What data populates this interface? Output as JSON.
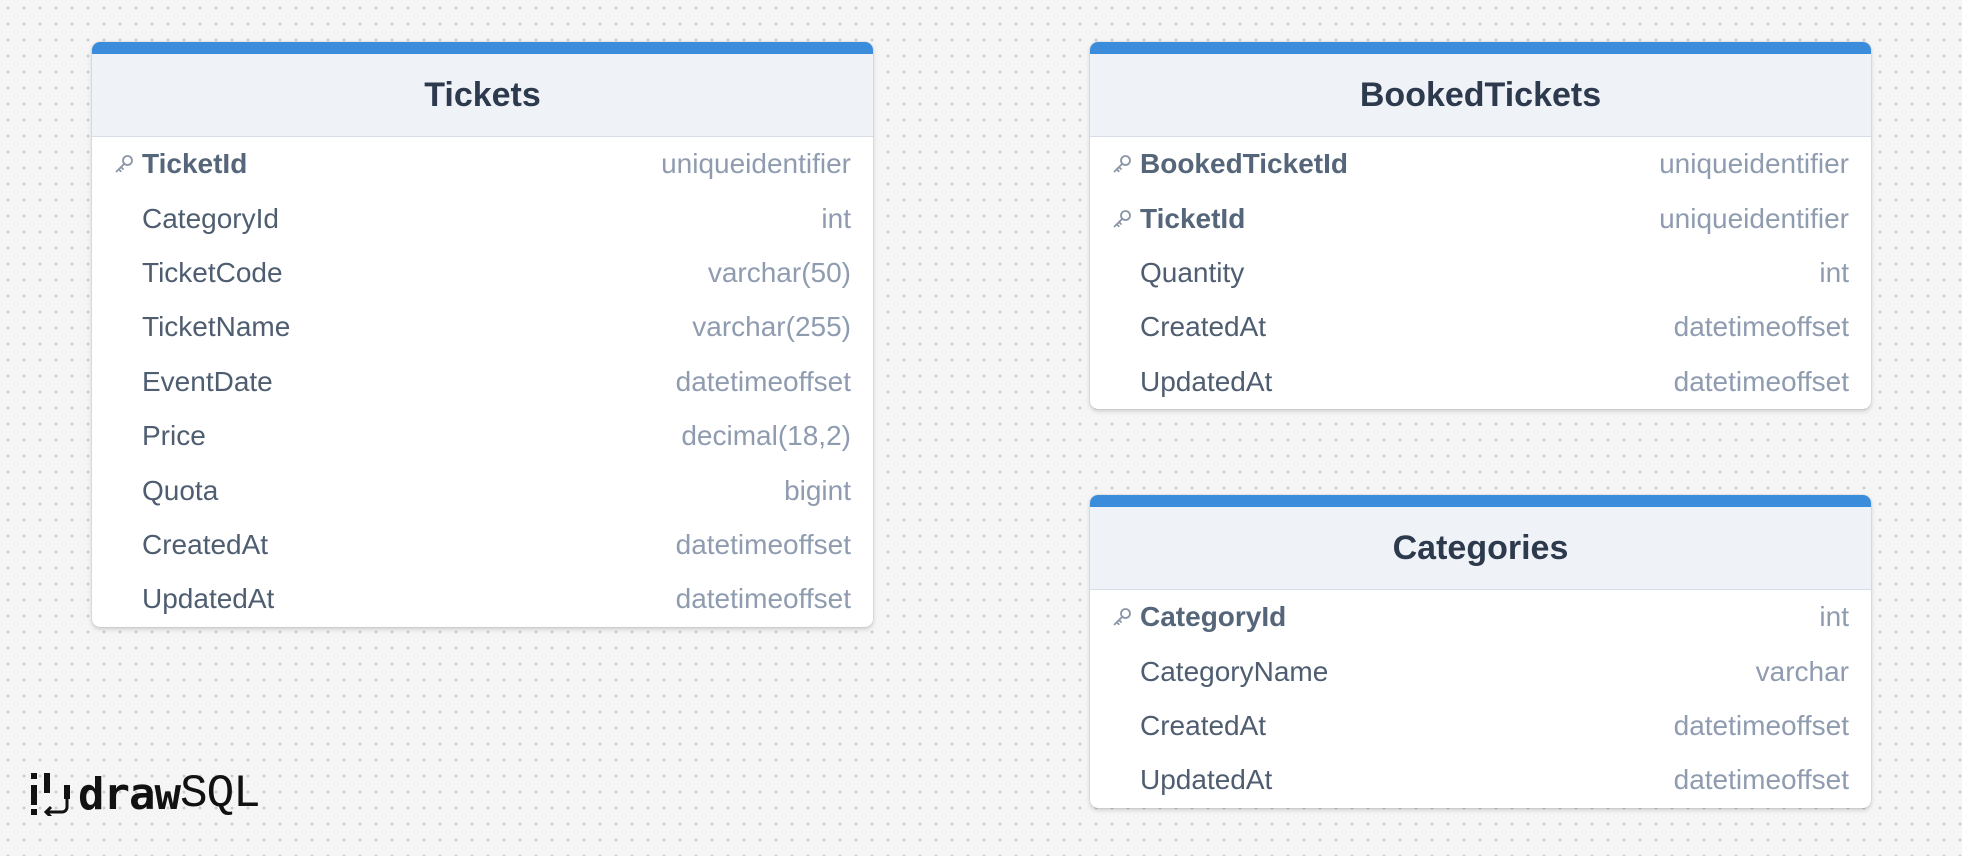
{
  "colors": {
    "accent": "#3b8ddb",
    "header_bg": "#eff3f8",
    "title_text": "#2d3a4d",
    "column_text": "#4e5d70",
    "type_text": "#8f9cb0",
    "canvas_bg": "#f5f5f5"
  },
  "tables": [
    {
      "name": "Tickets",
      "columns": [
        {
          "name": "TicketId",
          "type": "uniqueidentifier",
          "key": true
        },
        {
          "name": "CategoryId",
          "type": "int",
          "key": false
        },
        {
          "name": "TicketCode",
          "type": "varchar(50)",
          "key": false
        },
        {
          "name": "TicketName",
          "type": "varchar(255)",
          "key": false
        },
        {
          "name": "EventDate",
          "type": "datetimeoffset",
          "key": false
        },
        {
          "name": "Price",
          "type": "decimal(18,2)",
          "key": false
        },
        {
          "name": "Quota",
          "type": "bigint",
          "key": false
        },
        {
          "name": "CreatedAt",
          "type": "datetimeoffset",
          "key": false
        },
        {
          "name": "UpdatedAt",
          "type": "datetimeoffset",
          "key": false
        }
      ]
    },
    {
      "name": "BookedTickets",
      "columns": [
        {
          "name": "BookedTicketId",
          "type": "uniqueidentifier",
          "key": true
        },
        {
          "name": "TicketId",
          "type": "uniqueidentifier",
          "key": true
        },
        {
          "name": "Quantity",
          "type": "int",
          "key": false
        },
        {
          "name": "CreatedAt",
          "type": "datetimeoffset",
          "key": false
        },
        {
          "name": "UpdatedAt",
          "type": "datetimeoffset",
          "key": false
        }
      ]
    },
    {
      "name": "Categories",
      "columns": [
        {
          "name": "CategoryId",
          "type": "int",
          "key": true
        },
        {
          "name": "CategoryName",
          "type": "varchar",
          "key": false
        },
        {
          "name": "CreatedAt",
          "type": "datetimeoffset",
          "key": false
        },
        {
          "name": "UpdatedAt",
          "type": "datetimeoffset",
          "key": false
        }
      ]
    }
  ],
  "logo": {
    "part1": "draw",
    "part2": "SQL",
    "icon": "drawsql-logo-icon"
  }
}
